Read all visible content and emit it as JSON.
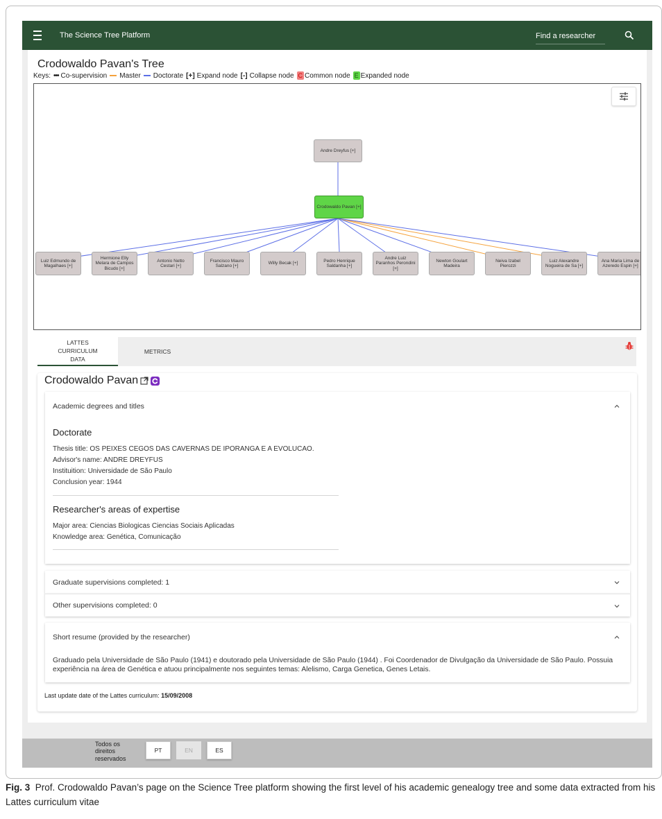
{
  "app": {
    "title": "The Science Tree Platform",
    "search_placeholder": "Find a researcher"
  },
  "tree": {
    "title": "Crodowaldo Pavan's Tree",
    "keys": {
      "prefix": "Keys:",
      "cosup": "Co-supervision",
      "master": "Master",
      "doctorate": "Doctorate",
      "expand_sym": "[+]",
      "expand": "Expand node",
      "collapse_sym": "[-]",
      "collapse": "Collapse node",
      "common_sym": "C",
      "common": "Common node",
      "expanded_sym": "E",
      "expanded": "Expanded node"
    },
    "colors": {
      "master": "#f5a23c",
      "doctorate": "#5b6ee6",
      "node": "#d3cbcb",
      "main_node": "#5fd547"
    },
    "advisor": "Andre Dreyfus [+]",
    "root": "Crodowaldo Pavan [+]",
    "children": [
      {
        "label": "Luiz Edmundo de Magalhaes [+]",
        "type": "doctorate"
      },
      {
        "label": "Hermione Elly Melara de Campos Bicudo [+]",
        "type": "doctorate"
      },
      {
        "label": "Antonio Netto Cestari [+]",
        "type": "doctorate"
      },
      {
        "label": "Francisco Mauro Salzano [+]",
        "type": "doctorate"
      },
      {
        "label": "Willy Becak [+]",
        "type": "doctorate"
      },
      {
        "label": "Pedro Henrique Saldanha [+]",
        "type": "doctorate"
      },
      {
        "label": "Andre Luiz Paranhos Perondini [+]",
        "type": "doctorate"
      },
      {
        "label": "Newton Goulart Madeira",
        "type": "doctorate"
      },
      {
        "label": "Neiva Izabel Pierozzi",
        "type": "master"
      },
      {
        "label": "Luiz Alexandre Nogueira de Sa [+]",
        "type": "master"
      },
      {
        "label": "Ana Maria Lima de Azeredo Espin [+]",
        "type": "doctorate"
      }
    ]
  },
  "tabs": [
    {
      "label": "LATTES CURRICULUM DATA"
    },
    {
      "label": "METRICS"
    }
  ],
  "profile": {
    "name": "Crodowaldo Pavan",
    "degrees_header": "Academic degrees and titles",
    "doctorate_heading": "Doctorate",
    "thesis": "Thesis title: OS PEIXES CEGOS DAS CAVERNAS DE IPORANGA E A EVOLUCAO.",
    "advisor": "Advisor's name: ANDRE DREYFUS",
    "institution": "Instituition: Universidade de São Paulo",
    "year": "Conclusion year: 1944",
    "areas_heading": "Researcher's areas of expertise",
    "major_area": "Major area: Ciencias Biologicas Ciencias Sociais Aplicadas",
    "knowledge_area": "Knowledge area: Genética, Comunicação",
    "grad_supervisions": "Graduate supervisions completed: 1",
    "other_supervisions": "Other supervisions completed: 0",
    "resume_header": "Short resume (provided by the researcher)",
    "resume_text": "Graduado pela Universidade de São Paulo (1941) e doutorado pela Universidade de São Paulo (1944) . Foi Coordenador de Divulgação da Universidade de São Paulo. Possuia experiência na área de Genética e atuou principalmente nos seguintes temas: Alelismo, Carga Genetica, Genes Letais.",
    "last_update_label": "Last update date of the Lattes curriculum:",
    "last_update_value": "15/09/2008"
  },
  "footer": {
    "rights": "Todos os direitos reservados",
    "lang_pt": "PT",
    "lang_en": "EN",
    "lang_es": "ES"
  },
  "caption": {
    "label": "Fig. 3",
    "text": "Prof. Crodowaldo Pavan’s page on the Science Tree platform showing the first level of his academic genealogy tree and some data extracted from his Lattes curriculum vitae"
  }
}
